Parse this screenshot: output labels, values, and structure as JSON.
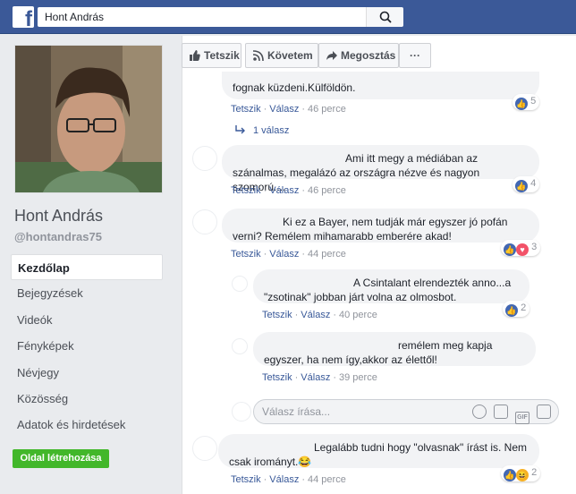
{
  "header": {
    "search_value": "Hont András"
  },
  "profile": {
    "name": "Hont András",
    "handle": "@hontandras75"
  },
  "nav": [
    {
      "label": "Kezdőlap",
      "active": true
    },
    {
      "label": "Bejegyzések"
    },
    {
      "label": "Videók"
    },
    {
      "label": "Fényképek"
    },
    {
      "label": "Névjegy"
    },
    {
      "label": "Közösség"
    },
    {
      "label": "Adatok és hirdetések"
    }
  ],
  "create_page_label": "Oldal létrehozása",
  "actions": {
    "like": "Tetszik",
    "follow": "Követem",
    "share": "Megosztás",
    "more": "···"
  },
  "labels": {
    "like": "Tetszik",
    "reply": "Válasz",
    "dot": "·"
  },
  "comments": [
    {
      "text": "fognak küzdeni.Külföldön.",
      "time": "46 perce",
      "reactions": "5"
    },
    {
      "text": "Ami itt megy a médiában az szánalmas, megalázó az országra nézve és nagyon szomorú....",
      "time": "46 perce",
      "reactions": "4"
    },
    {
      "text": "Ki ez a Bayer, nem tudják már egyszer jó pofán verni? Remélem mihamarabb emberére akad!",
      "time": "44 perce",
      "reactions": "3"
    },
    {
      "text": "A Csintalant elrendezték anno...a \"zsotinak\" jobban járt volna az olmosbot.",
      "time": "40 perce",
      "reactions": "2"
    },
    {
      "text": "remélem meg kapja egyszer, ha nem így,akkor az élettől!",
      "time": "39 perce",
      "reactions": ""
    },
    {
      "text": "Legalább tudni hogy \"olvasnak\" írást is. Nem csak irományt.😂",
      "time": "44 perce",
      "reactions": "2"
    }
  ],
  "replies_link": "1 válasz",
  "reply_placeholder": "Válasz írása...",
  "gif_label": "GIF",
  "colors": {
    "brand": "#3b5998",
    "link": "#385898",
    "button_green": "#42b72a"
  }
}
